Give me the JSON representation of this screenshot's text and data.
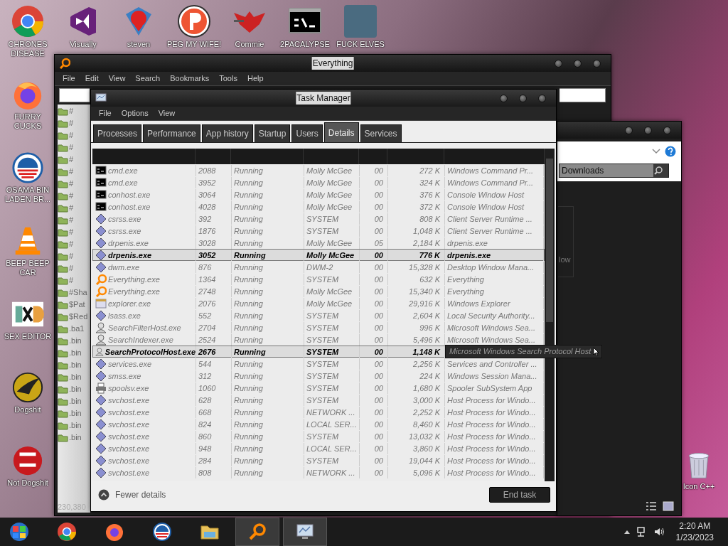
{
  "desktop": {
    "top_row": [
      {
        "label": "CHRONES DISEASE",
        "kind": "chrome"
      },
      {
        "label": "Visually",
        "kind": "vs"
      },
      {
        "label": "steven",
        "kind": "diamond"
      },
      {
        "label": "PEG MY WIFE!",
        "kind": "p"
      },
      {
        "label": "Commie",
        "kind": "emblem"
      },
      {
        "label": "2PACALYPSE",
        "kind": "cmd"
      },
      {
        "label": "FUCK ELVES",
        "kind": "photo"
      }
    ],
    "left_column": [
      {
        "label": "FURRY CUCKS",
        "kind": "firefox"
      },
      {
        "label": "OSAMA BIN LADEN BR...",
        "kind": "striped"
      },
      {
        "label": "BEEP BEEP CAR",
        "kind": "cone"
      },
      {
        "label": "SEX EDITOR",
        "kind": "square"
      },
      {
        "label": "Dogshit",
        "kind": "coin"
      },
      {
        "label": "Not Dogshit",
        "kind": "badge"
      }
    ],
    "right_column": [
      {
        "label": "Icon C++",
        "kind": "bin"
      }
    ]
  },
  "everything": {
    "title": "Everything",
    "menu": [
      "File",
      "Edit",
      "View",
      "Search",
      "Bookmarks",
      "Tools",
      "Help"
    ],
    "files": [
      "#",
      "#",
      "#",
      "#",
      "#",
      "#",
      "#",
      "#",
      "#",
      "#",
      "#",
      "#",
      "#",
      "#",
      "#",
      "#Sha",
      "$Pat",
      "$Red",
      ".ba1",
      ".bin",
      ".bin",
      ".bin",
      ".bin",
      ".bin",
      ".bin",
      ".bin",
      ".bin",
      ".bin"
    ],
    "status": "230,380"
  },
  "explorer": {
    "search_placeholder": "Downloads",
    "fragment": "low"
  },
  "task_manager": {
    "title": "Task Manager",
    "menu": [
      "File",
      "Options",
      "View"
    ],
    "tabs": [
      {
        "label": "Processes",
        "selected": false
      },
      {
        "label": "Performance",
        "selected": false
      },
      {
        "label": "App history",
        "selected": false
      },
      {
        "label": "Startup",
        "selected": false
      },
      {
        "label": "Users",
        "selected": false
      },
      {
        "label": "Details",
        "selected": true
      },
      {
        "label": "Services",
        "selected": false
      }
    ],
    "rows": [
      {
        "kind": "console",
        "name": "cmd.exe",
        "pid": "2088",
        "status": "Running",
        "user": "Molly McGee",
        "cpu": "00",
        "memory": "272 K",
        "description": "Windows Command Pr...",
        "selected": false
      },
      {
        "kind": "console",
        "name": "cmd.exe",
        "pid": "3952",
        "status": "Running",
        "user": "Molly McGee",
        "cpu": "00",
        "memory": "324 K",
        "description": "Windows Command Pr...",
        "selected": false
      },
      {
        "kind": "console",
        "name": "conhost.exe",
        "pid": "3064",
        "status": "Running",
        "user": "Molly McGee",
        "cpu": "00",
        "memory": "376 K",
        "description": "Console Window Host",
        "selected": false
      },
      {
        "kind": "console",
        "name": "conhost.exe",
        "pid": "4028",
        "status": "Running",
        "user": "Molly McGee",
        "cpu": "00",
        "memory": "372 K",
        "description": "Console Window Host",
        "selected": false
      },
      {
        "kind": "diamond",
        "name": "csrss.exe",
        "pid": "392",
        "status": "Running",
        "user": "SYSTEM",
        "cpu": "00",
        "memory": "808 K",
        "description": "Client Server Runtime ...",
        "selected": false
      },
      {
        "kind": "diamond",
        "name": "csrss.exe",
        "pid": "1876",
        "status": "Running",
        "user": "SYSTEM",
        "cpu": "00",
        "memory": "1,048 K",
        "description": "Client Server Runtime ...",
        "selected": false
      },
      {
        "kind": "diamond",
        "name": "drpenis.exe",
        "pid": "3028",
        "status": "Running",
        "user": "Molly McGee",
        "cpu": "05",
        "memory": "2,184 K",
        "description": "drpenis.exe",
        "selected": false
      },
      {
        "kind": "diamond",
        "name": "drpenis.exe",
        "pid": "3052",
        "status": "Running",
        "user": "Molly McGee",
        "cpu": "00",
        "memory": "776 K",
        "description": "drpenis.exe",
        "selected": true
      },
      {
        "kind": "diamond",
        "name": "dwm.exe",
        "pid": "876",
        "status": "Running",
        "user": "DWM-2",
        "cpu": "00",
        "memory": "15,328 K",
        "description": "Desktop Window Mana...",
        "selected": false
      },
      {
        "kind": "magnifier",
        "name": "Everything.exe",
        "pid": "1364",
        "status": "Running",
        "user": "SYSTEM",
        "cpu": "00",
        "memory": "632 K",
        "description": "Everything",
        "selected": false
      },
      {
        "kind": "magnifier",
        "name": "Everything.exe",
        "pid": "2748",
        "status": "Running",
        "user": "Molly McGee",
        "cpu": "00",
        "memory": "15,340 K",
        "description": "Everything",
        "selected": false
      },
      {
        "kind": "explorer",
        "name": "explorer.exe",
        "pid": "2076",
        "status": "Running",
        "user": "Molly McGee",
        "cpu": "00",
        "memory": "29,916 K",
        "description": "Windows Explorer",
        "selected": false
      },
      {
        "kind": "diamond",
        "name": "lsass.exe",
        "pid": "552",
        "status": "Running",
        "user": "SYSTEM",
        "cpu": "00",
        "memory": "2,604 K",
        "description": "Local Security Authority...",
        "selected": false
      },
      {
        "kind": "person",
        "name": "SearchFilterHost.exe",
        "pid": "2704",
        "status": "Running",
        "user": "SYSTEM",
        "cpu": "00",
        "memory": "996 K",
        "description": "Microsoft Windows Sea...",
        "selected": false
      },
      {
        "kind": "person",
        "name": "SearchIndexer.exe",
        "pid": "2524",
        "status": "Running",
        "user": "SYSTEM",
        "cpu": "00",
        "memory": "5,496 K",
        "description": "Microsoft Windows Sea...",
        "selected": false
      },
      {
        "kind": "person",
        "name": "SearchProtocolHost.exe",
        "pid": "2676",
        "status": "Running",
        "user": "SYSTEM",
        "cpu": "00",
        "memory": "1,148 K",
        "tooltip": "Microsoft Windows Search Protocol Host",
        "selected": true
      },
      {
        "kind": "diamond",
        "name": "services.exe",
        "pid": "544",
        "status": "Running",
        "user": "SYSTEM",
        "cpu": "00",
        "memory": "2,256 K",
        "description": "Services and Controller ...",
        "selected": false
      },
      {
        "kind": "diamond",
        "name": "smss.exe",
        "pid": "312",
        "status": "Running",
        "user": "SYSTEM",
        "cpu": "00",
        "memory": "224 K",
        "description": "Windows Session Mana...",
        "selected": false
      },
      {
        "kind": "printer",
        "name": "spoolsv.exe",
        "pid": "1060",
        "status": "Running",
        "user": "SYSTEM",
        "cpu": "00",
        "memory": "1,680 K",
        "description": "Spooler SubSystem App",
        "selected": false
      },
      {
        "kind": "diamond",
        "name": "svchost.exe",
        "pid": "628",
        "status": "Running",
        "user": "SYSTEM",
        "cpu": "00",
        "memory": "3,000 K",
        "description": "Host Process for Windo...",
        "selected": false
      },
      {
        "kind": "diamond",
        "name": "svchost.exe",
        "pid": "668",
        "status": "Running",
        "user": "NETWORK ...",
        "cpu": "00",
        "memory": "2,252 K",
        "description": "Host Process for Windo...",
        "selected": false
      },
      {
        "kind": "diamond",
        "name": "svchost.exe",
        "pid": "824",
        "status": "Running",
        "user": "LOCAL SER...",
        "cpu": "00",
        "memory": "8,460 K",
        "description": "Host Process for Windo...",
        "selected": false
      },
      {
        "kind": "diamond",
        "name": "svchost.exe",
        "pid": "860",
        "status": "Running",
        "user": "SYSTEM",
        "cpu": "00",
        "memory": "13,032 K",
        "description": "Host Process for Windo...",
        "selected": false
      },
      {
        "kind": "diamond",
        "name": "svchost.exe",
        "pid": "948",
        "status": "Running",
        "user": "LOCAL SER...",
        "cpu": "00",
        "memory": "3,860 K",
        "description": "Host Process for Windo...",
        "selected": false
      },
      {
        "kind": "diamond",
        "name": "svchost.exe",
        "pid": "284",
        "status": "Running",
        "user": "SYSTEM",
        "cpu": "00",
        "memory": "19,044 K",
        "description": "Host Process for Windo...",
        "selected": false
      },
      {
        "kind": "diamond",
        "name": "svchost.exe",
        "pid": "808",
        "status": "Running",
        "user": "NETWORK ...",
        "cpu": "00",
        "memory": "5,096 K",
        "description": "Host Process for Windo...",
        "selected": false
      }
    ],
    "fewer_details": "Fewer details",
    "end_task": "End task"
  },
  "taskbar": {
    "apps": [
      {
        "kind": "orb",
        "active": false
      },
      {
        "kind": "chrome",
        "active": false
      },
      {
        "kind": "firefox",
        "active": false
      },
      {
        "kind": "striped",
        "active": false
      },
      {
        "kind": "folder",
        "active": false
      },
      {
        "kind": "magnifier",
        "active": true
      },
      {
        "kind": "monitor",
        "active": true
      }
    ],
    "time": "2:20 AM",
    "date": "1/23/2023"
  }
}
